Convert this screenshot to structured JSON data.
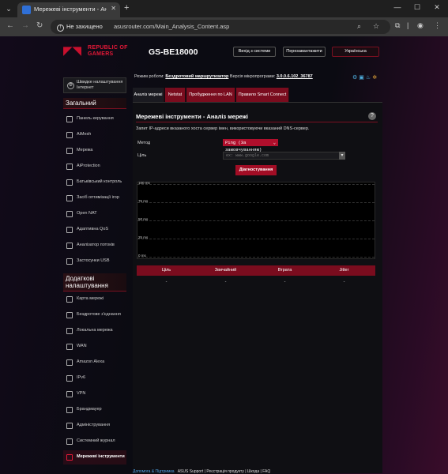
{
  "browser": {
    "tab_title": "Мережеві інструменти - Аналі",
    "url_warning": "Не захищено",
    "url": "asusrouter.com/Main_Analysis_Content.asp"
  },
  "header": {
    "brand_line1": "REPUBLIC OF",
    "brand_line2": "GAMERS",
    "model": "GS-BE18000",
    "logout": "Вихід з системи",
    "reboot": "Перезавантажити",
    "language": "Українська"
  },
  "sidebar": {
    "quick_setup": "Швидке налаштування Інтернет",
    "general_title": "Загальний",
    "general_items": [
      {
        "label": "Панель керування",
        "icon": "dashboard-icon"
      },
      {
        "label": "AiMesh",
        "icon": "aimesh-icon"
      },
      {
        "label": "Мережа",
        "icon": "network-icon"
      },
      {
        "label": "AiProtection",
        "icon": "shield-icon"
      },
      {
        "label": "Батьківський контроль",
        "icon": "parental-icon"
      },
      {
        "label": "Засіб оптимізації ігор",
        "icon": "game-boost-icon"
      },
      {
        "label": "Open NAT",
        "icon": "open-nat-icon"
      },
      {
        "label": "Адаптивна QoS",
        "icon": "qos-icon"
      },
      {
        "label": "Аналізатор потоків",
        "icon": "traffic-analyzer-icon"
      },
      {
        "label": "Застосунки USB",
        "icon": "usb-icon"
      }
    ],
    "advanced_title": "Додаткові налаштування",
    "advanced_items": [
      {
        "label": "Карта мережі",
        "icon": "network-map-icon"
      },
      {
        "label": "Бездротове з'єднання",
        "icon": "wireless-icon"
      },
      {
        "label": "Локальна мережа",
        "icon": "lan-icon"
      },
      {
        "label": "WAN",
        "icon": "wan-icon"
      },
      {
        "label": "Amazon Alexa",
        "icon": "alexa-icon"
      },
      {
        "label": "IPv6",
        "icon": "ipv6-icon"
      },
      {
        "label": "VPN",
        "icon": "vpn-icon"
      },
      {
        "label": "Брандмауер",
        "icon": "firewall-icon"
      },
      {
        "label": "Адміністрування",
        "icon": "admin-icon"
      },
      {
        "label": "Системний журнал",
        "icon": "syslog-icon"
      },
      {
        "label": "Мережеві інструменти",
        "icon": "network-tools-icon",
        "active": true
      }
    ]
  },
  "status": {
    "mode_label": "Режим роботи:",
    "mode_value": "Бездротовий маршрутизатор",
    "fw_label": "Версія мікропрограми:",
    "fw_value": "3.0.0.6.102_36787"
  },
  "tabs": [
    "Аналіз мережі",
    "Netstat",
    "Пробудження по LAN",
    "Правило Smart Connect"
  ],
  "panel": {
    "title": "Мережеві інструменти - Аналіз мережі",
    "description": "Запит IP-адреси вказаного хоста сервер імен, використовуючи вказаний DNS-сервер.",
    "method_label": "Метод",
    "method_value": "Ping (За замовчуванням)",
    "target_label": "Ціль",
    "target_placeholder": "ex: www.google.com",
    "diagnose_button": "Діагностування"
  },
  "chart_data": {
    "type": "line",
    "y_ticks": [
      "100 ms",
      "75 ms",
      "50 ms",
      "25 ms",
      "0 ms"
    ],
    "ylim": [
      0,
      100
    ],
    "series": []
  },
  "results": {
    "headers": [
      "Ціль",
      "Звичайний",
      "Втрата",
      "Jitter"
    ],
    "values": [
      "-",
      "-",
      "-",
      "-"
    ]
  },
  "footer": {
    "help_link": "Допомога & Підтримка",
    "links": "ASUS Support | Реєстрація продукту | Шкода | FAQ"
  }
}
